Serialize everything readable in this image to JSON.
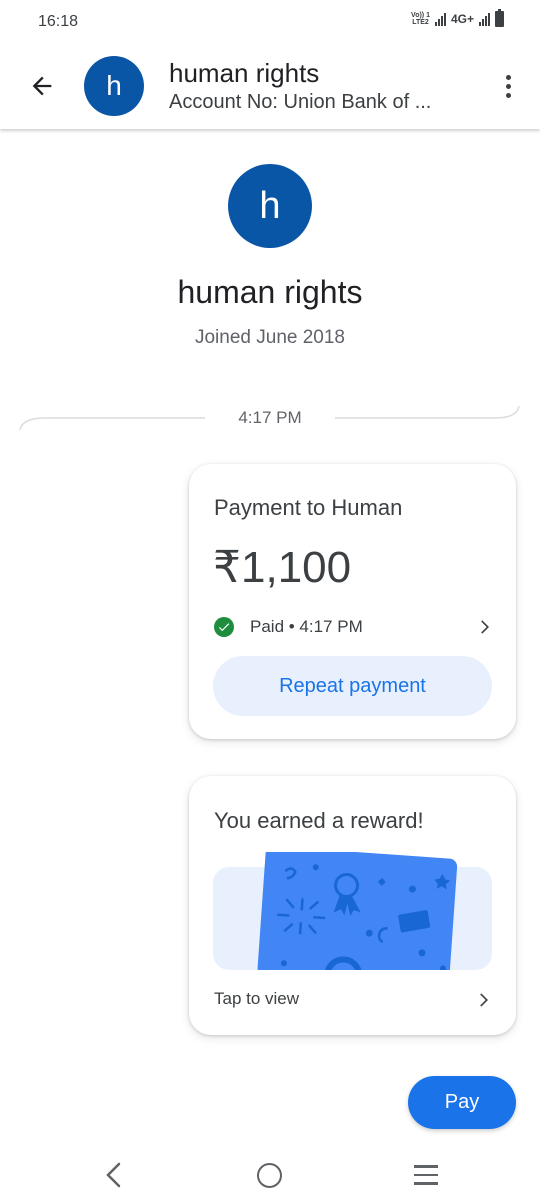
{
  "status_bar": {
    "time": "16:18",
    "volte_line1": "Vo)) 1",
    "volte_line2": "LTE2",
    "network": "4G+"
  },
  "header": {
    "avatar_letter": "h",
    "name": "human rights",
    "subtitle": "Account No: Union Bank of ..."
  },
  "profile": {
    "avatar_letter": "h",
    "name": "human rights",
    "joined": "Joined June 2018"
  },
  "conversation": {
    "timestamp": "4:17 PM"
  },
  "payment_card": {
    "title": "Payment to Human",
    "amount": "₹1,100",
    "status": "Paid • 4:17 PM",
    "repeat_label": "Repeat payment"
  },
  "reward_card": {
    "title": "You earned a reward!",
    "tap_label": "Tap to view"
  },
  "pay_button": {
    "label": "Pay"
  },
  "colors": {
    "accent": "#1a73e8",
    "avatar": "#0a56a6",
    "paid_green": "#1e8e3e",
    "reward_card": "#4285f4",
    "reward_bg": "#e8f0fd"
  },
  "icons": [
    "back-arrow-icon",
    "more-vert-icon",
    "check-circle-icon",
    "chevron-right-icon",
    "nav-back-icon",
    "nav-home-icon",
    "nav-recents-icon"
  ]
}
